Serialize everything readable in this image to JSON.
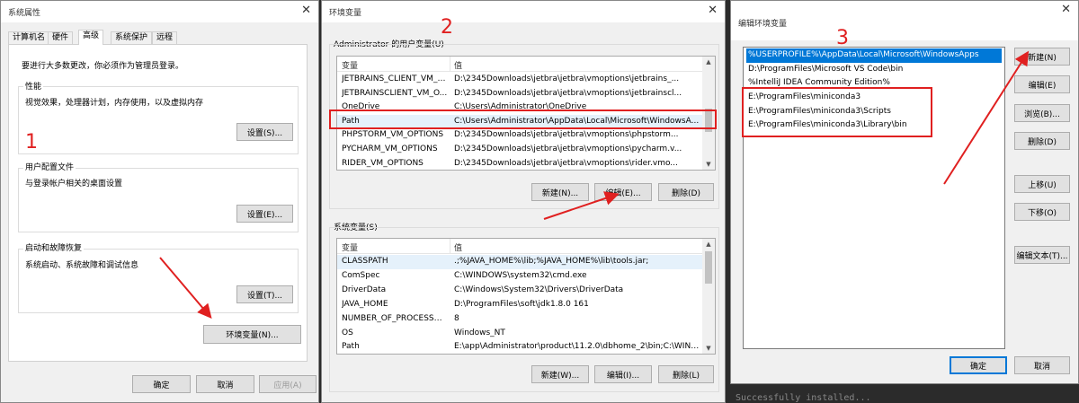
{
  "sysprop": {
    "title": "系统属性",
    "tabs": [
      "计算机名",
      "硬件",
      "高级",
      "系统保护",
      "远程"
    ],
    "admin_note": "要进行大多数更改，你必须作为管理员登录。",
    "perf_title": "性能",
    "perf_desc": "视觉效果，处理器计划，内存使用，以及虚拟内存",
    "settings_btn": "设置(S)...",
    "profile_title": "用户配置文件",
    "profile_desc": "与登录帐户相关的桌面设置",
    "settings_e_btn": "设置(E)...",
    "startup_title": "启动和故障恢复",
    "startup_desc": "系统启动、系统故障和调试信息",
    "settings_t_btn": "设置(T)...",
    "env_btn": "环境变量(N)...",
    "ok": "确定",
    "cancel": "取消",
    "apply": "应用(A)"
  },
  "envvars": {
    "title": "环境变量",
    "user_group": "Administrator 的用户变量(U)",
    "col_var": "变量",
    "col_val": "值",
    "user_rows": [
      {
        "name": "JETBRAINS_CLIENT_VM_O...",
        "value": "D:\\2345Downloads\\jetbra\\jetbra\\vmoptions\\jetbrains_..."
      },
      {
        "name": "JETBRAINSCLIENT_VM_O...",
        "value": "D:\\2345Downloads\\jetbra\\jetbra\\vmoptions\\jetbrainscl..."
      },
      {
        "name": "OneDrive",
        "value": "C:\\Users\\Administrator\\OneDrive"
      },
      {
        "name": "Path",
        "value": "C:\\Users\\Administrator\\AppData\\Local\\Microsoft\\WindowsA..."
      },
      {
        "name": "PHPSTORM_VM_OPTIONS",
        "value": "D:\\2345Downloads\\jetbra\\jetbra\\vmoptions\\phpstorm..."
      },
      {
        "name": "PYCHARM_VM_OPTIONS",
        "value": "D:\\2345Downloads\\jetbra\\jetbra\\vmoptions\\pycharm.v..."
      },
      {
        "name": "RIDER_VM_OPTIONS",
        "value": "D:\\2345Downloads\\jetbra\\jetbra\\vmoptions\\rider.vmo..."
      }
    ],
    "new_btn": "新建(N)...",
    "edit_btn": "编辑(E)...",
    "delete_btn": "删除(D)",
    "sys_group": "系统变量(S)",
    "sys_rows": [
      {
        "name": "CLASSPATH",
        "value": ".;%JAVA_HOME%\\lib;%JAVA_HOME%\\lib\\tools.jar;"
      },
      {
        "name": "ComSpec",
        "value": "C:\\WINDOWS\\system32\\cmd.exe"
      },
      {
        "name": "DriverData",
        "value": "C:\\Windows\\System32\\Drivers\\DriverData"
      },
      {
        "name": "JAVA_HOME",
        "value": "D:\\ProgramFiles\\soft\\jdk1.8.0 161"
      },
      {
        "name": "NUMBER_OF_PROCESSORS",
        "value": "8"
      },
      {
        "name": "OS",
        "value": "Windows_NT"
      },
      {
        "name": "Path",
        "value": "E:\\app\\Administrator\\product\\11.2.0\\dbhome_2\\bin;C:\\WIND..."
      }
    ],
    "sys_new_btn": "新建(W)...",
    "sys_edit_btn": "编辑(I)...",
    "sys_delete_btn": "删除(L)"
  },
  "editenv": {
    "title": "编辑环境变量",
    "items": [
      "%USERPROFILE%\\AppData\\Local\\Microsoft\\WindowsApps",
      "D:\\ProgramFiles\\Microsoft VS Code\\bin",
      "%IntelliJ IDEA Community Edition%",
      "E:\\ProgramFiles\\miniconda3",
      "E:\\ProgramFiles\\miniconda3\\Scripts",
      "E:\\ProgramFiles\\miniconda3\\Library\\bin"
    ],
    "new_btn": "新建(N)",
    "edit_btn": "编辑(E)",
    "browse_btn": "浏览(B)...",
    "delete_btn": "删除(D)",
    "up_btn": "上移(U)",
    "down_btn": "下移(O)",
    "edit_text_btn": "编辑文本(T)...",
    "ok": "确定",
    "cancel": "取消"
  },
  "annotations": {
    "one": "1",
    "two": "2",
    "three": "3"
  },
  "terminal_text": "Successfully installed..."
}
